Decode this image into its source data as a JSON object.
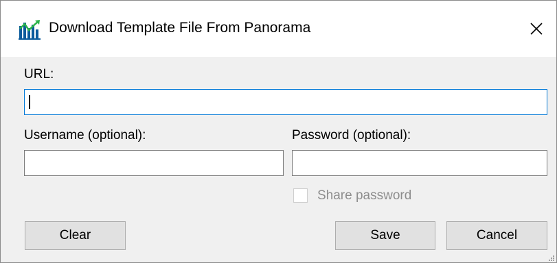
{
  "window": {
    "title": "Download Template File From Panorama",
    "app_icon": "panorama-chart-icon",
    "close_icon": "close-icon"
  },
  "form": {
    "url_label": "URL:",
    "url_value": "",
    "username_label": "Username (optional):",
    "username_value": "",
    "password_label": "Password (optional):",
    "password_value": "",
    "share_password_label": "Share password",
    "share_password_checked": false,
    "share_password_enabled": false
  },
  "buttons": {
    "clear": "Clear",
    "save": "Save",
    "cancel": "Cancel"
  },
  "colors": {
    "focus_border": "#0078d7",
    "disabled_text": "#8d8d8d",
    "button_face": "#e1e1e1"
  }
}
